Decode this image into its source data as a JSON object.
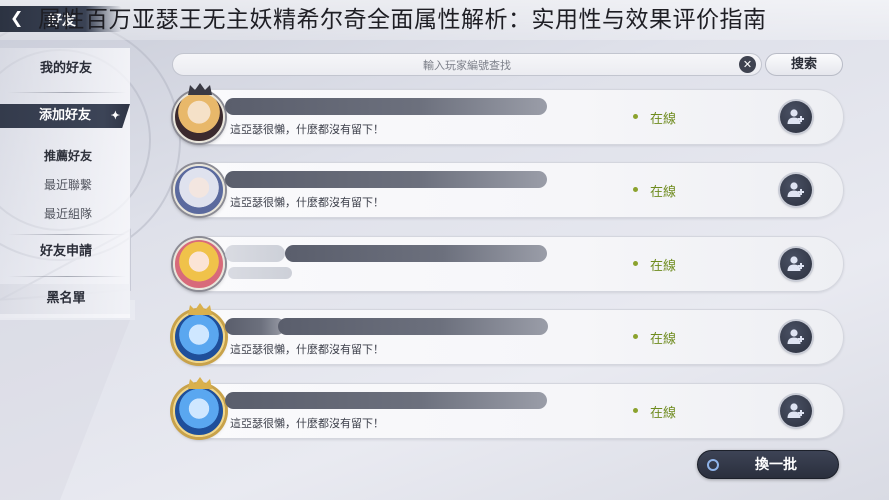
{
  "overlay_title": "属性百万亚瑟王无主妖精希尔奇全面属性解析：实用性与效果评价指南",
  "header": {
    "back_label": "好友"
  },
  "sidebar": {
    "items": [
      {
        "label": "我的好友"
      },
      {
        "label": "添加好友"
      },
      {
        "label": "推薦好友"
      },
      {
        "label": "最近聯繫"
      },
      {
        "label": "最近組隊"
      },
      {
        "label": "好友申請"
      },
      {
        "label": "黑名單"
      }
    ]
  },
  "search": {
    "placeholder": "輸入玩家編號查找",
    "button_label": "搜索"
  },
  "friends": [
    {
      "message": "這亞瑟很懶，什麼都沒有留下！",
      "status": "在線"
    },
    {
      "message": "這亞瑟很懶，什麼都沒有留下！",
      "status": "在線"
    },
    {
      "message": "",
      "status": "在線"
    },
    {
      "message": "這亞瑟很懶，什麼都沒有留下！",
      "status": "在線"
    },
    {
      "message": "這亞瑟很懶，什麼都沒有留下！",
      "status": "在線"
    }
  ],
  "refresh_label": "換一批",
  "colors": {
    "online_green": "#6e8b1e",
    "dark_button": "#2b303e",
    "active_tab": "#343b4c"
  }
}
